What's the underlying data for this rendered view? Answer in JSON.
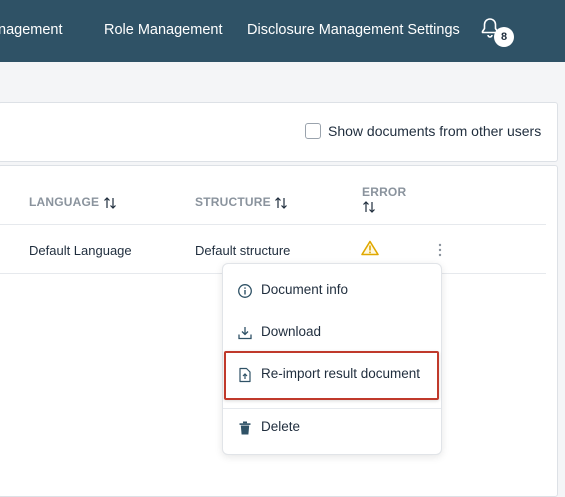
{
  "nav": {
    "items": [
      "nagement",
      "Role Management",
      "Disclosure Management Settings"
    ],
    "notifications_count": "8"
  },
  "filter": {
    "show_other_users_label": "Show documents from other users",
    "show_other_users_checked": false
  },
  "table": {
    "columns": [
      "LANGUAGE",
      "STRUCTURE",
      "ERROR"
    ],
    "rows": [
      {
        "language": "Default Language",
        "structure": "Default structure",
        "error_icon": "warning-icon"
      }
    ]
  },
  "context_menu": {
    "items": [
      {
        "label": "Document info",
        "icon": "info-icon"
      },
      {
        "label": "Download",
        "icon": "download-icon"
      },
      {
        "label": "Re-import result document",
        "icon": "file-upload-icon",
        "highlighted": true
      },
      {
        "label": "Delete",
        "icon": "trash-icon"
      }
    ]
  },
  "colors": {
    "topbar": "#2f5266",
    "warning": "#e0a800",
    "highlight": "#c0392b"
  }
}
